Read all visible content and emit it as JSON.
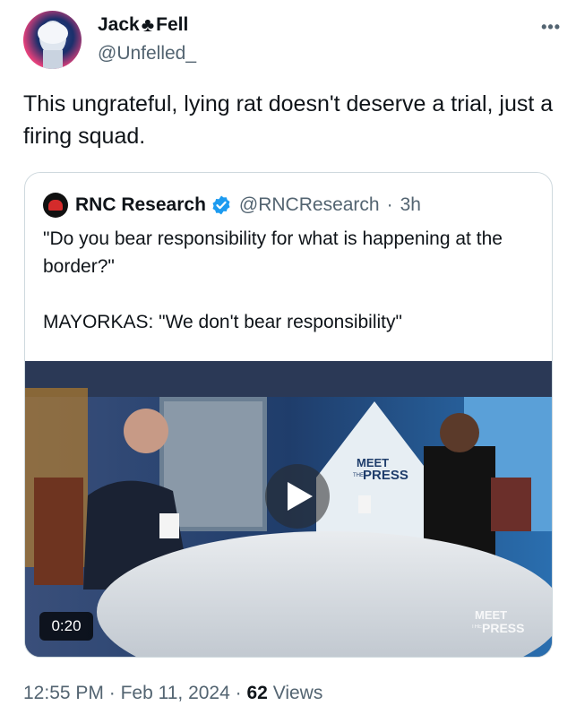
{
  "author": {
    "name_part1": "Jack",
    "name_symbol": "♣",
    "name_part2": "Fell",
    "handle": "@Unfelled_"
  },
  "more_label": "•••",
  "tweet": {
    "text": "This ungrateful, lying rat doesn't deserve a trial, just a firing squad."
  },
  "quoted": {
    "name": "RNC Research",
    "handle": "@RNCResearch",
    "separator": "·",
    "time": "3h",
    "line1": "\"Do you bear responsibility for what is happening at the border?\"",
    "line2": "MAYORKAS: \"We don't bear responsibility\"",
    "video": {
      "duration": "0:20",
      "set_logo_line1": "MEET",
      "set_logo_the": "THE",
      "set_logo_line2": "PRESS",
      "corner_logo_line1": "MEET",
      "corner_logo_the": "THE",
      "corner_logo_line2": "PRESS"
    }
  },
  "footer": {
    "time": "12:55 PM",
    "sep1": "·",
    "date": "Feb 11, 2024",
    "sep2": "·",
    "views_count": "62",
    "views_label": "Views"
  },
  "colors": {
    "verified": "#1d9bf0",
    "secondary_text": "#536471",
    "border": "#cfd9de"
  }
}
